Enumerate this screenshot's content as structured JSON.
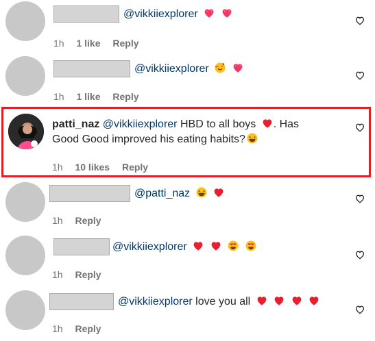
{
  "comments": [
    {
      "mention": "@vikkiiexplorer",
      "text": "",
      "time": "1h",
      "likes": "1 like",
      "reply": "Reply"
    },
    {
      "mention": "@vikkiiexplorer",
      "text": "",
      "time": "1h",
      "likes": "1 like",
      "reply": "Reply"
    },
    {
      "username": "patti_naz",
      "mention": "@vikkiiexplorer",
      "text": "HBD to all boys",
      "text2": ". Has",
      "line2": "Good Good improved his eating habits?",
      "time": "1h",
      "likes": "10 likes",
      "reply": "Reply"
    },
    {
      "mention": "@patti_naz",
      "text": "",
      "time": "1h",
      "reply": "Reply"
    },
    {
      "mention": "@vikkiiexplorer",
      "text": "",
      "time": "1h",
      "reply": "Reply"
    },
    {
      "mention": "@vikkiiexplorer",
      "text": "love you all",
      "time": "1h",
      "reply": "Reply"
    }
  ],
  "colors": {
    "highlight": "#e01f26",
    "heart_emoji": "#e8202e",
    "mention": "#00376b"
  },
  "icons": [
    "heart-outline-icon",
    "heart-emoji",
    "laughing-emoji",
    "heart-eyes-emoji",
    "sparkling-heart-emoji"
  ]
}
